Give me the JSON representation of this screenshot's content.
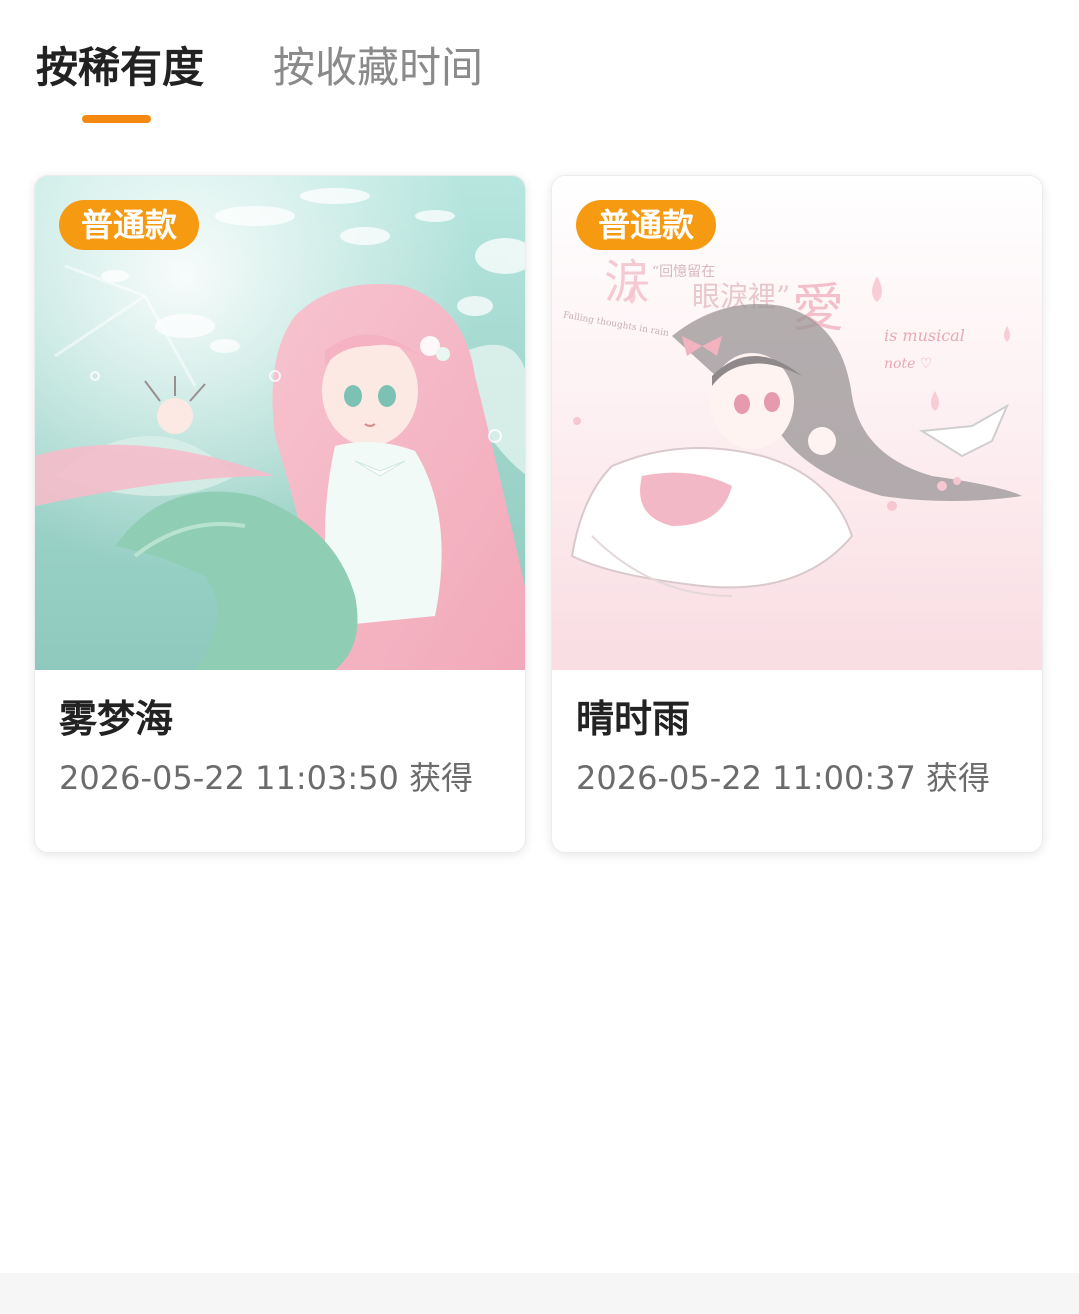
{
  "tabs": {
    "active_label": "按稀有度",
    "inactive_label": "按收藏时间"
  },
  "cards": [
    {
      "badge": "普通款",
      "title": "雾梦海",
      "date": "2026-05-22 11:03:50 获得",
      "image_icon": "mermaid-illustration",
      "colors": {
        "bg": "#a9ded3",
        "accent": "#f3b9c6"
      }
    },
    {
      "badge": "普通款",
      "title": "晴时雨",
      "date": "2026-05-22 11:00:37 获得",
      "image_icon": "lying-girl-illustration",
      "colors": {
        "bg": "#fbe6ea",
        "accent": "#f0a9b8"
      },
      "art_text": {
        "left_char": "涙",
        "caption_1": "“回憶留在",
        "caption_2": "眼淚裡”",
        "big_char": "愛",
        "script_1": "is musical",
        "script_2": "note ♡",
        "side_text": "Falling thoughts in rain"
      }
    }
  ],
  "theme": {
    "accent": "#f5890f",
    "badge": "#f69a12"
  }
}
